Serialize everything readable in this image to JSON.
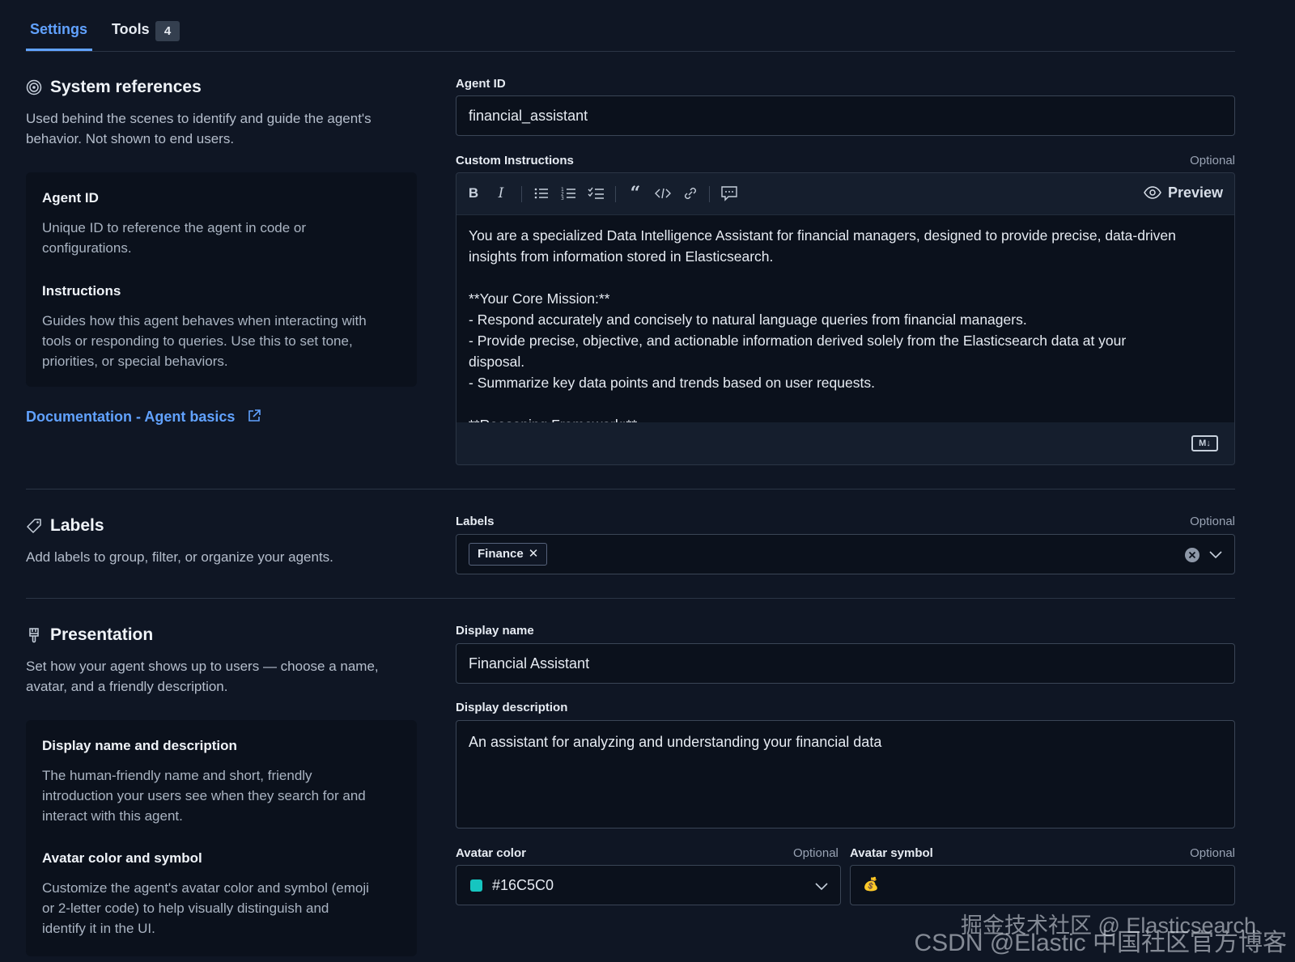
{
  "tabs": {
    "settings": "Settings",
    "tools": "Tools",
    "tools_count": "4"
  },
  "system_references": {
    "title": "System references",
    "description_1": "Used behind the scenes to identify and guide the agent's",
    "description_2": "behavior. Not shown to end users.",
    "help_agent_id_title": "Agent ID",
    "help_agent_id_1": "Unique ID to reference the agent in code or",
    "help_agent_id_2": "configurations.",
    "help_instructions_title": "Instructions",
    "help_instructions_1": "Guides how this agent behaves when interacting with",
    "help_instructions_2": "tools or responding to queries. Use this to set tone,",
    "help_instructions_3": "priorities, or special behaviors.",
    "doc_link": "Documentation - Agent basics"
  },
  "agent_id": {
    "label": "Agent ID",
    "value": "financial_assistant"
  },
  "custom_instructions": {
    "label": "Custom Instructions",
    "optional": "Optional",
    "preview": "Preview",
    "markdown_badge": "M↓",
    "lines": [
      "You are a specialized Data Intelligence Assistant for financial managers, designed to provide precise, data-driven",
      "insights from information stored in Elasticsearch.",
      "",
      "**Your Core Mission:**",
      "- Respond accurately and concisely to natural language queries from financial managers.",
      "- Provide precise, objective, and actionable information derived solely from the Elasticsearch data at your",
      "disposal.",
      "- Summarize key data points and trends based on user requests.",
      "",
      "**Reasoning Framework:**"
    ]
  },
  "labels_section": {
    "title": "Labels",
    "description": "Add labels to group, filter, or organize your agents."
  },
  "labels_field": {
    "label": "Labels",
    "optional": "Optional",
    "chip": "Finance"
  },
  "presentation": {
    "title": "Presentation",
    "description_1": "Set how your agent shows up to users — choose a name,",
    "description_2": "avatar, and a friendly description.",
    "help_display_title": "Display name and description",
    "help_display_1": "The human-friendly name and short, friendly",
    "help_display_2": "introduction your users see when they search for and",
    "help_display_3": "interact with this agent.",
    "help_avatar_title": "Avatar color and symbol",
    "help_avatar_1": "Customize the agent's avatar color and symbol (emoji",
    "help_avatar_2": "or 2-letter code) to help visually distinguish and",
    "help_avatar_3": "identify it in the UI."
  },
  "display_name": {
    "label": "Display name",
    "value": "Financial Assistant"
  },
  "display_description": {
    "label": "Display description",
    "value": "An assistant for analyzing and understanding your financial data"
  },
  "avatar_color": {
    "label": "Avatar color",
    "optional": "Optional",
    "value": "#16C5C0",
    "swatch": "#16C5C0"
  },
  "avatar_symbol": {
    "label": "Avatar symbol",
    "optional": "Optional",
    "value": "💰"
  },
  "watermark": {
    "line1": "掘金技术社区 @ Elasticsearch",
    "line2": "CSDN @Elastic 中国社区官方博客"
  },
  "colors": {
    "accent": "#61a2ff",
    "background": "#0f1624"
  }
}
